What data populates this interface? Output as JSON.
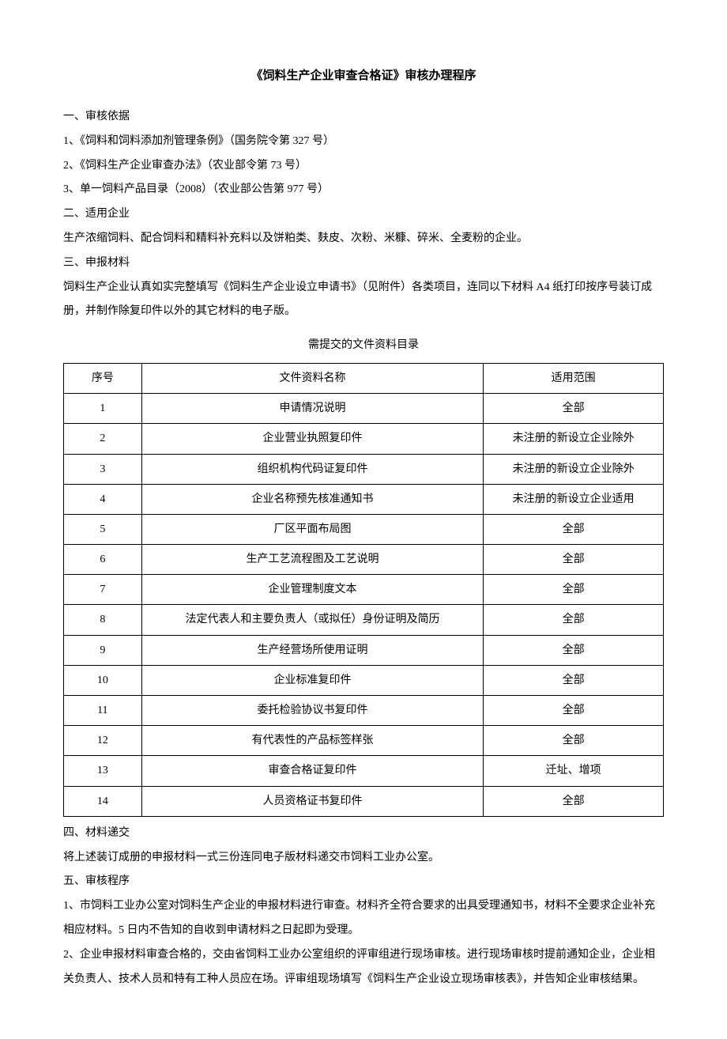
{
  "title": "《饲料生产企业审查合格证》审核办理程序",
  "s1_h": "一、审核依据",
  "s1_l1": "1、《饲料和饲料添加剂管理条例》（国务院令第 327 号）",
  "s1_l2": "2、《饲料生产企业审查办法》（农业部令第 73 号）",
  "s1_l3": "3、单一饲料产品目录（2008）（农业部公告第 977 号）",
  "s2_h": "二、适用企业",
  "s2_l1": "生产浓缩饲料、配合饲料和精料补充料以及饼粕类、麸皮、次粉、米糠、碎米、全麦粉的企业。",
  "s3_h": "三、申报材料",
  "s3_l1": "饲料生产企业认真如实完整填写《饲料生产企业设立申请书》（见附件）各类项目，连同以下材料 A4 纸打印按序号装订成册，并制作除复印件以外的其它材料的电子版。",
  "table_caption": "需提交的文件资料目录",
  "th1": "序号",
  "th2": "文件资料名称",
  "th3": "适用范围",
  "rows": [
    {
      "n": "1",
      "name": "申请情况说明",
      "scope": "全部"
    },
    {
      "n": "2",
      "name": "企业营业执照复印件",
      "scope": "未注册的新设立企业除外"
    },
    {
      "n": "3",
      "name": "组织机构代码证复印件",
      "scope": "未注册的新设立企业除外"
    },
    {
      "n": "4",
      "name": "企业名称预先核准通知书",
      "scope": "未注册的新设立企业适用"
    },
    {
      "n": "5",
      "name": "厂区平面布局图",
      "scope": "全部"
    },
    {
      "n": "6",
      "name": "生产工艺流程图及工艺说明",
      "scope": "全部"
    },
    {
      "n": "7",
      "name": "企业管理制度文本",
      "scope": "全部"
    },
    {
      "n": "8",
      "name": "法定代表人和主要负责人（或拟任）身份证明及简历",
      "scope": "全部"
    },
    {
      "n": "9",
      "name": "生产经营场所使用证明",
      "scope": "全部"
    },
    {
      "n": "10",
      "name": "企业标准复印件",
      "scope": "全部"
    },
    {
      "n": "11",
      "name": "委托检验协议书复印件",
      "scope": "全部"
    },
    {
      "n": "12",
      "name": "有代表性的产品标签样张",
      "scope": "全部"
    },
    {
      "n": "13",
      "name": "审查合格证复印件",
      "scope": "迁址、增项"
    },
    {
      "n": "14",
      "name": "人员资格证书复印件",
      "scope": "全部"
    }
  ],
  "s4_h": "四、材料递交",
  "s4_l1": "将上述装订成册的申报材料一式三份连同电子版材料递交市饲料工业办公室。",
  "s5_h": "五、审核程序",
  "s5_l1": "1、市饲料工业办公室对饲料生产企业的申报材料进行审查。材料齐全符合要求的出具受理通知书，材料不全要求企业补充相应材料。5 日内不告知的自收到申请材料之日起即为受理。",
  "s5_l2": "2、企业申报材料审查合格的，交由省饲料工业办公室组织的评审组进行现场审核。进行现场审核时提前通知企业，企业相关负责人、技术人员和特有工种人员应在场。评审组现场填写《饲料生产企业设立现场审核表》，并告知企业审核结果。"
}
